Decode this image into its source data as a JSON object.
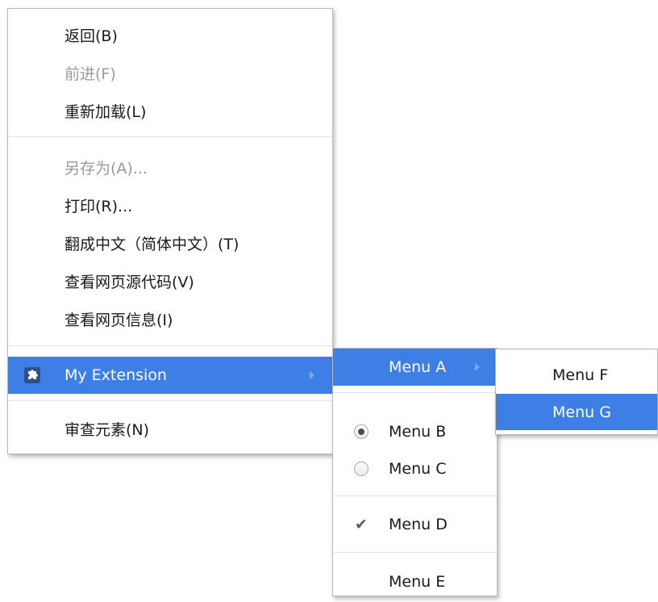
{
  "main_menu": {
    "items": [
      {
        "label": "返回(B)",
        "state": "enabled"
      },
      {
        "label": "前进(F)",
        "state": "disabled"
      },
      {
        "label": "重新加载(L)",
        "state": "enabled"
      },
      {
        "label": "另存为(A)...",
        "state": "disabled"
      },
      {
        "label": "打印(R)...",
        "state": "enabled"
      },
      {
        "label": "翻成中文（简体中文）(T)",
        "state": "enabled"
      },
      {
        "label": "查看网页源代码(V)",
        "state": "enabled"
      },
      {
        "label": "查看网页信息(I)",
        "state": "enabled"
      },
      {
        "label": "My Extension",
        "state": "highlighted",
        "icon": "puzzle-piece-icon",
        "has_submenu": true
      },
      {
        "label": "审查元素(N)",
        "state": "enabled"
      }
    ]
  },
  "extension_menu": {
    "items": [
      {
        "label": "Menu A",
        "state": "highlighted",
        "has_submenu": true
      },
      {
        "label": "Menu B",
        "type": "radio",
        "selected": true
      },
      {
        "label": "Menu C",
        "type": "radio",
        "selected": false
      },
      {
        "label": "Menu D",
        "type": "checkbox",
        "checked": true
      },
      {
        "label": "Menu E",
        "type": "normal"
      }
    ]
  },
  "menu_a_submenu": {
    "items": [
      {
        "label": "Menu F",
        "state": "enabled"
      },
      {
        "label": "Menu G",
        "state": "highlighted"
      }
    ]
  },
  "colors": {
    "highlight": "#3d7fe5",
    "disabled_text": "#9a9a9a",
    "separator": "#e3e3e3",
    "border": "#b9b9b9"
  }
}
